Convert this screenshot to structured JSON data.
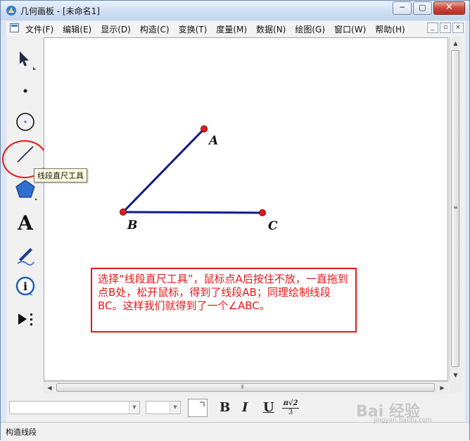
{
  "window": {
    "title": "几何画板 - [未命名1]",
    "buttons": {
      "minimize": "─",
      "maximize": "▢",
      "close": "✕"
    }
  },
  "menu": {
    "items": [
      "文件(F)",
      "编辑(E)",
      "显示(D)",
      "构造(C)",
      "变换(T)",
      "度量(M)",
      "数据(N)",
      "绘图(G)",
      "窗口(W)",
      "帮助(H)"
    ],
    "mdi_buttons": [
      "_",
      "▫",
      "×"
    ]
  },
  "toolbox": {
    "tools": [
      {
        "name": "arrow-select-tool",
        "icon": "arrow-icon"
      },
      {
        "name": "point-tool",
        "icon": "point-icon"
      },
      {
        "name": "compass-tool",
        "icon": "circle-icon"
      },
      {
        "name": "straightedge-tool",
        "icon": "line-segment-icon"
      },
      {
        "name": "polygon-tool",
        "icon": "pentagon-icon"
      },
      {
        "name": "text-tool",
        "icon": "letter-a-icon",
        "label": "A"
      },
      {
        "name": "marker-tool",
        "icon": "pen-icon"
      },
      {
        "name": "information-tool",
        "icon": "info-icon",
        "label": "i"
      },
      {
        "name": "custom-tool",
        "icon": "play-dots-icon"
      }
    ],
    "tooltip": "线段直尺工具",
    "highlight_color": "#e5191a"
  },
  "canvas": {
    "points": [
      {
        "label": "A",
        "color": "#e5191a"
      },
      {
        "label": "B",
        "color": "#e5191a"
      },
      {
        "label": "C",
        "color": "#e5191a"
      }
    ],
    "segment_color": "#0d1a8a",
    "callout_text": "选择“线段直尺工具”，鼠标点A后按住不放，一直拖到点B处，松开鼠标，得到了线段AB；同理绘制线段BC。这样我们就得到了一个∠ABC。",
    "callout_color": "#e5191a"
  },
  "textbar": {
    "font_name": "",
    "font_size": "",
    "bold": "B",
    "italic": "I",
    "underline": "U",
    "math_top": "π√2",
    "math_bottom": "3"
  },
  "status": {
    "text": "构造线段"
  },
  "watermark": {
    "text": "Bai 经验",
    "sub": "jingyan.baidu.com"
  }
}
